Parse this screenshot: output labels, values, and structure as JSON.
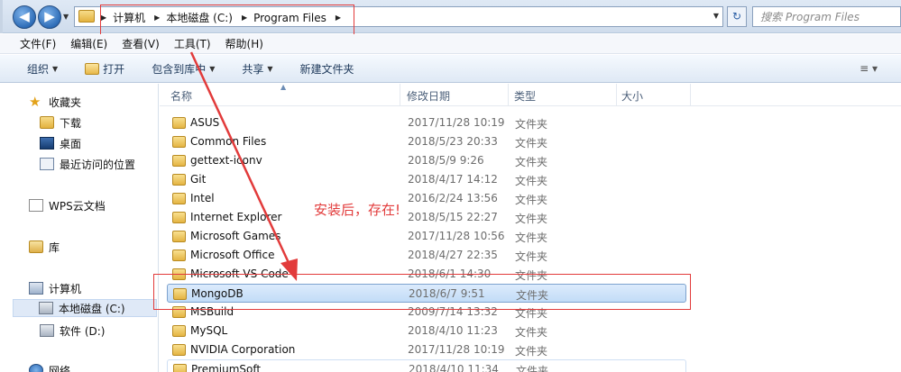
{
  "address_bar": {
    "breadcrumbs": [
      "计算机",
      "本地磁盘 (C:)",
      "Program Files"
    ],
    "search_placeholder": "搜索 Program Files"
  },
  "menu": [
    "文件(F)",
    "编辑(E)",
    "查看(V)",
    "工具(T)",
    "帮助(H)"
  ],
  "commands": {
    "organize": "组织",
    "open": "打开",
    "include_library": "包含到库中",
    "share": "共享",
    "new_folder": "新建文件夹"
  },
  "sidebar": {
    "favorites": "收藏夹",
    "downloads": "下载",
    "desktop": "桌面",
    "recent": "最近访问的位置",
    "wps": "WPS云文档",
    "libraries": "库",
    "computer": "计算机",
    "drive_c": "本地磁盘 (C:)",
    "drive_d": "软件 (D:)",
    "network": "网络"
  },
  "columns": [
    "名称",
    "修改日期",
    "类型",
    "大小"
  ],
  "files": [
    {
      "name": "ASUS",
      "date": "2017/11/28 10:19",
      "type": "文件夹"
    },
    {
      "name": "Common Files",
      "date": "2018/5/23 20:33",
      "type": "文件夹"
    },
    {
      "name": "gettext-iconv",
      "date": "2018/5/9 9:26",
      "type": "文件夹"
    },
    {
      "name": "Git",
      "date": "2018/4/17 14:12",
      "type": "文件夹"
    },
    {
      "name": "Intel",
      "date": "2016/2/24 13:56",
      "type": "文件夹"
    },
    {
      "name": "Internet Explorer",
      "date": "2018/5/15 22:27",
      "type": "文件夹"
    },
    {
      "name": "Microsoft Games",
      "date": "2017/11/28 10:56",
      "type": "文件夹"
    },
    {
      "name": "Microsoft Office",
      "date": "2018/4/27 22:35",
      "type": "文件夹"
    },
    {
      "name": "Microsoft VS Code",
      "date": "2018/6/1 14:30",
      "type": "文件夹"
    },
    {
      "name": "MongoDB",
      "date": "2018/6/7 9:51",
      "type": "文件夹"
    },
    {
      "name": "MSBuild",
      "date": "2009/7/14 13:32",
      "type": "文件夹"
    },
    {
      "name": "MySQL",
      "date": "2018/4/10 11:23",
      "type": "文件夹"
    },
    {
      "name": "NVIDIA Corporation",
      "date": "2017/11/28 10:19",
      "type": "文件夹"
    },
    {
      "name": "PremiumSoft",
      "date": "2018/4/10 11:34",
      "type": "文件夹"
    }
  ],
  "annotation": "安装后，存在!",
  "colors": {
    "annotation_red": "#e23b3b",
    "selection": "#c2dcf7"
  }
}
